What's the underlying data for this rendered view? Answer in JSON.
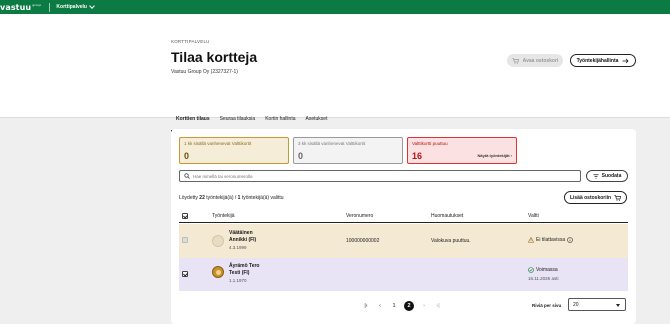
{
  "topbar": {
    "logo": "vastuu",
    "logo_sup": "group",
    "product": "Korttipalvelu"
  },
  "header": {
    "breadcrumb": "KORTTIPALVELU",
    "title": "Tilaa kortteja",
    "company": "Vastuu Group Oy (2327327-1)",
    "cart_button": "Avaa ostoskori",
    "manage_button": "Työntekijähallinta"
  },
  "tabs": [
    {
      "label": "Korttien tilaus",
      "active": true
    },
    {
      "label": "Seuraa tilauksia",
      "active": false
    },
    {
      "label": "Kortin hallinta",
      "active": false
    },
    {
      "label": "Asetukset",
      "active": false
    }
  ],
  "summary": {
    "expiring_1m": {
      "label": "1 kk sisällä vanhenevat Valttikortit",
      "count": "0"
    },
    "expiring_3m": {
      "label": "3 kk sisällä vanhenevat Valttikortit",
      "count": "0"
    },
    "missing": {
      "label": "Valttikortti puuttuu",
      "count": "16",
      "link": "Näytä työntekijät"
    }
  },
  "search": {
    "placeholder": "Hae nimellä tai veronumerolla"
  },
  "filter_button": "Suodata",
  "results": {
    "prefix": "Löydetty",
    "total": "22",
    "middle": "työntekijä(ä) /",
    "selected": "1",
    "suffix": "työntekijä(ä) valittu"
  },
  "add_to_cart_button": "Lisää ostoskoriin",
  "table": {
    "columns": [
      "Työntekijä",
      "Veronumero",
      "Huomautukset",
      "Valtti"
    ],
    "rows": [
      {
        "name_line1": "Väätäinen",
        "name_line2": "Annikki (FI)",
        "dob": "4.3.1999",
        "tax_number": "100000000002",
        "note": "Valokuva puuttuu.",
        "valtti_status": "Ei tilattavissa",
        "valtti_date": "",
        "checked": false,
        "disabled": true
      },
      {
        "name_line1": "Äyrämö Tero",
        "name_line2": "Testi (FI)",
        "dob": "1.1.1970",
        "tax_number": "",
        "note": "",
        "valtti_status": "Voimassa",
        "valtti_date": "16.11.2026 asti",
        "checked": true,
        "disabled": false
      }
    ]
  },
  "pagination": {
    "pages": [
      "1",
      "2"
    ],
    "current": "2",
    "rows_per_page_label": "Riviä per sivu",
    "rows_per_page_value": "20"
  },
  "colors": {
    "brand_green": "#0b7a43",
    "warning": "#c79a2e",
    "error": "#d33333",
    "success": "#1b7f3e"
  }
}
